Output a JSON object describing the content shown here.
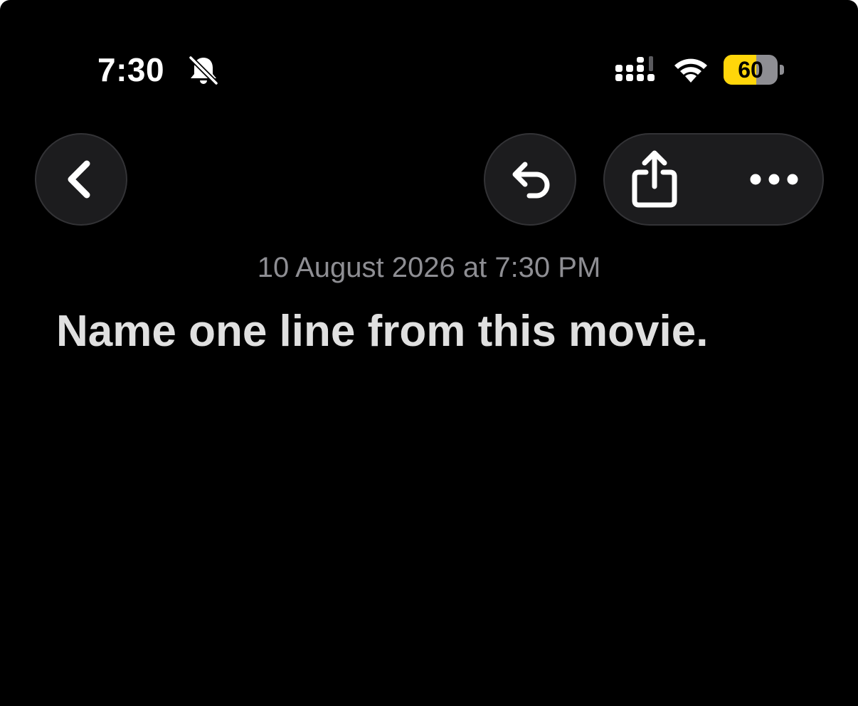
{
  "status_bar": {
    "time": "7:30",
    "battery_level": "60",
    "battery_fraction": 0.6,
    "icons": [
      "bell-slash-icon",
      "cellular-signal-icon",
      "wifi-icon",
      "battery-icon"
    ]
  },
  "toolbar": {
    "icons": {
      "back": "chevron-left-icon",
      "undo": "undo-arrow-icon",
      "share": "share-icon",
      "more": "ellipsis-icon"
    }
  },
  "note": {
    "date": "10 August 2026 at 7:30 PM",
    "title": "Name one line from this movie."
  },
  "colors": {
    "background": "#000000",
    "button_bg": "#1c1c1e",
    "secondary_text": "#8e8e93",
    "title_text": "#e0e0e0",
    "battery_yellow": "#ffd60a"
  }
}
